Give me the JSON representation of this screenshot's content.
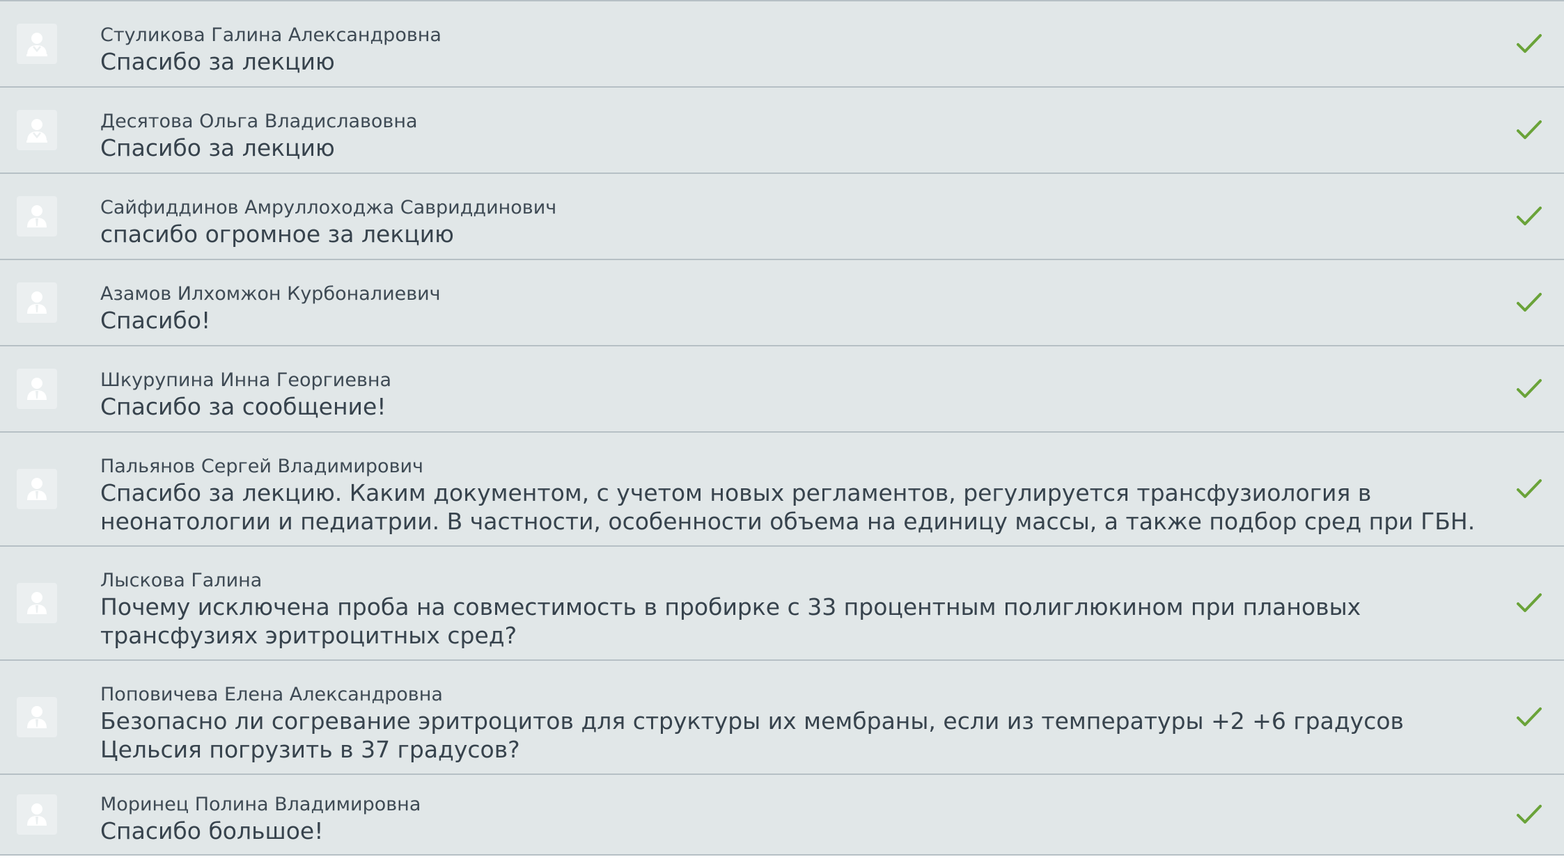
{
  "colors": {
    "row_background": "#e1e7e8",
    "divider": "#b6c0c5",
    "text": "#3e4a54",
    "check": "#6aa339",
    "avatar_background": "#ebeff0",
    "avatar_glyph": "#ffffff"
  },
  "icons": {
    "avatar": "user-silhouette-icon",
    "status": "checkmark-icon"
  },
  "messages": [
    {
      "author": "Стуликова Галина Александровна",
      "text": "Спасибо за лекцию",
      "avatar": "female"
    },
    {
      "author": "Десятова Ольга Владиславовна",
      "text": "Спасибо за лекцию",
      "avatar": "female"
    },
    {
      "author": "Сайфиддинов Амруллоходжа Савриддинович",
      "text": "спасибо огромное за лекцию",
      "avatar": "male"
    },
    {
      "author": "Азамов Илхомжон Курбоналиевич",
      "text": "Спасибо!",
      "avatar": "male"
    },
    {
      "author": "Шкурупина Инна Георгиевна",
      "text": "Спасибо за сообщение!",
      "avatar": "male"
    },
    {
      "author": "Пальянов Сергей Владимирович",
      "text": "Спасибо за лекцию. Каким документом, с учетом новых регламентов, регулируется трансфузиология в неонатологии и педиатрии. В частности, особенности объема на единицу массы, а также подбор сред при ГБН.",
      "avatar": "male"
    },
    {
      "author": "Лыскова Галина",
      "text": "Почему исключена проба на совместимость в пробирке с 33 процентным полиглюкином при плановых трансфузиях эритроцитных сред?",
      "avatar": "male"
    },
    {
      "author": "Поповичева Елена Александровна",
      "text": "Безопасно ли согревание эритроцитов для структуры их мембраны, если из температуры +2 +6 градусов Цельсия погрузить в 37 градусов?",
      "avatar": "male"
    },
    {
      "author": "Моринец Полина Владимировна",
      "text": "Спасибо большое!",
      "avatar": "male"
    }
  ]
}
